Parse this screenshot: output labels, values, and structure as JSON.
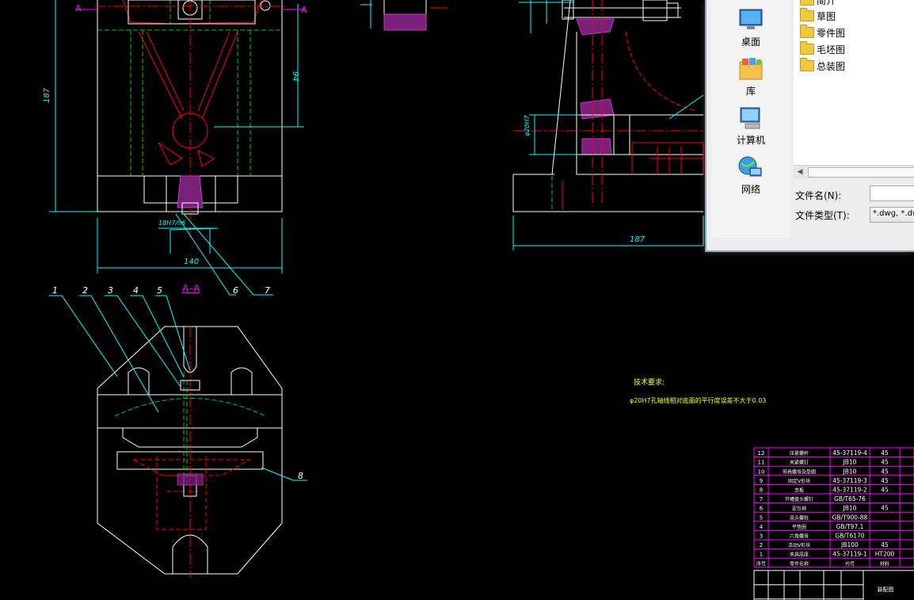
{
  "drawing": {
    "section_label": "A–A",
    "view_marks": [
      "A",
      "A"
    ],
    "dimensions": {
      "height_left": "187",
      "width_bottom": "140",
      "height_right": "94",
      "small_fit": "18H7/h6",
      "right_width": "187",
      "right_dia": "φ20H7"
    },
    "part_balloons": [
      "1",
      "2",
      "3",
      "4",
      "5",
      "6",
      "7",
      "8"
    ],
    "tech_title": "技术要求:",
    "tech_note": "φ20H7孔轴线相对底面的平行度误差不大于0.03"
  },
  "bom": {
    "rows": [
      {
        "no": "12",
        "name": "压紧螺杆",
        "code": "45-37119-4",
        "qty": "",
        "mat": "45"
      },
      {
        "no": "11",
        "name": "夹紧螺钉",
        "code": "JB10",
        "qty": "",
        "mat": "45"
      },
      {
        "no": "10",
        "name": "带肩螺母及垫圈",
        "code": "JB10",
        "qty": "",
        "mat": "45"
      },
      {
        "no": "9",
        "name": "固定V形块",
        "code": "45-37119-3",
        "qty": "",
        "mat": "45"
      },
      {
        "no": "8",
        "name": "支板",
        "code": "45-37119-2",
        "qty": "",
        "mat": "45"
      },
      {
        "no": "7",
        "name": "开槽盘头螺钉",
        "code": "GB/T65-76",
        "qty": "",
        "mat": ""
      },
      {
        "no": "6",
        "name": "定位销",
        "code": "JB10",
        "qty": "",
        "mat": "45"
      },
      {
        "no": "5",
        "name": "双头螺柱",
        "code": "GB/T900-88",
        "qty": "",
        "mat": ""
      },
      {
        "no": "4",
        "name": "平垫圈",
        "code": "GB/T97.1",
        "qty": "",
        "mat": ""
      },
      {
        "no": "3",
        "name": "六角螺母",
        "code": "GB/T6170",
        "qty": "",
        "mat": ""
      },
      {
        "no": "2",
        "name": "活动V形块",
        "code": "JB100",
        "qty": "",
        "mat": "45"
      },
      {
        "no": "1",
        "name": "夹具底座",
        "code": "45-37119-1",
        "qty": "",
        "mat": "HT200"
      }
    ],
    "header": {
      "no": "序号",
      "name": "零件名称",
      "code": "代号",
      "mat": "材料"
    },
    "title_block": "装配图"
  },
  "dialog": {
    "places": [
      {
        "label": "桌面",
        "icon": "desktop-icon"
      },
      {
        "label": "库",
        "icon": "library-icon"
      },
      {
        "label": "计算机",
        "icon": "computer-icon"
      },
      {
        "label": "网络",
        "icon": "network-icon"
      }
    ],
    "files": [
      "简介",
      "草图",
      "零件图",
      "毛坯图",
      "总装图"
    ],
    "filename_label": "文件名(N):",
    "filename_value": "",
    "filetype_label": "文件类型(T):",
    "filetype_value": "*.dwg, *.dws"
  },
  "colors": {
    "background": "#000000",
    "outline": "#ffffff",
    "dimension": "#00ffff",
    "hidden": "#00cc00",
    "center": "#ff0000",
    "hatch": "#cc33cc",
    "table": "#ff00ff"
  }
}
